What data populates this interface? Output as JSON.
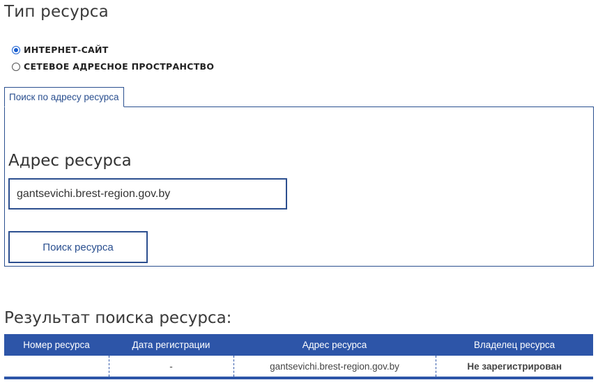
{
  "resource_type": {
    "title": "Тип ресурса",
    "options": [
      {
        "label": "ИНТЕРНЕТ-САЙТ",
        "checked": true
      },
      {
        "label": "СЕТЕВОЕ АДРЕСНОЕ ПРОСТРАНСТВО",
        "checked": false
      }
    ]
  },
  "search": {
    "tab_label": "Поиск по адресу ресурса",
    "field_label": "Адрес ресурса",
    "input_value": "gantsevichi.brest-region.gov.by",
    "button_label": "Поиск ресурса"
  },
  "results": {
    "title": "Результат поиска ресурса:",
    "columns": [
      "Номер ресурса",
      "Дата регистрации",
      "Адрес ресурса",
      "Владелец ресурса"
    ],
    "rows": [
      {
        "number": "",
        "date": "-",
        "address": "gantsevichi.brest-region.gov.by",
        "owner": "Не зарегистрирован"
      }
    ]
  },
  "colors": {
    "accent": "#2d55a8",
    "border": "#2a4f8f",
    "status_unregistered": "#e00000"
  }
}
